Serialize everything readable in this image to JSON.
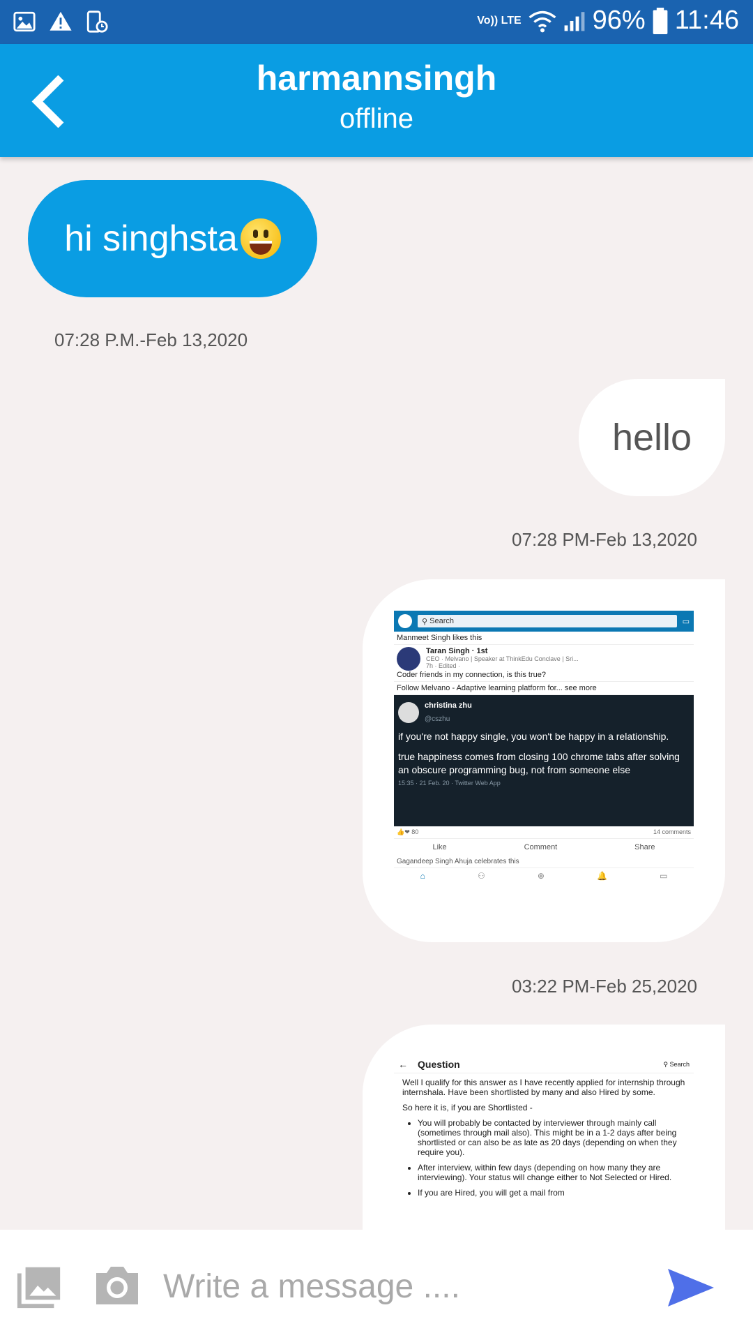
{
  "status_bar": {
    "battery": "96%",
    "time": "11:46",
    "network": "Vo)) LTE"
  },
  "header": {
    "title": "harmannsingh",
    "subtitle": "offline"
  },
  "messages": [
    {
      "direction": "incoming",
      "text": "hi singhsta",
      "timestamp": "07:28 P.M.-Feb 13,2020"
    },
    {
      "direction": "outgoing",
      "text": "hello",
      "timestamp": "07:28 PM-Feb 13,2020"
    },
    {
      "direction": "outgoing",
      "type": "image",
      "timestamp": "03:22 PM-Feb 25,2020"
    },
    {
      "direction": "outgoing",
      "type": "image"
    }
  ],
  "shot1": {
    "search": "Search",
    "liked": "Manmeet Singh likes this",
    "author": "Taran Singh · 1st",
    "author_desc": "CEO · Melvano | Speaker at ThinkEdu Conclave | Sri...",
    "author_time": "7h · Edited ·",
    "post_text": "Coder friends in my connection, is this true?",
    "follow_text": "Follow Melvano - Adaptive learning platform for... see more",
    "tweet_name": "christina zhu",
    "tweet_handle": "@cszhu",
    "tweet_line1": "if you're not happy single, you won't be happy in a relationship.",
    "tweet_line2": "true happiness comes from closing 100 chrome tabs after solving an obscure programming bug, not from someone else",
    "tweet_meta": "15:35 · 21 Feb. 20 · Twitter Web App",
    "reactions": "80",
    "comments": "14 comments",
    "like": "Like",
    "comment": "Comment",
    "share": "Share",
    "next_post": "Gagandeep Singh Ahuja celebrates this"
  },
  "shot2": {
    "title": "Question",
    "search": "Search",
    "p1": "Well I qualify for this answer as I have recently applied for internship through internshala. Have been shortlisted by many and also Hired by some.",
    "p2": "So here it is, if you are Shortlisted -",
    "li1": "You will probably be contacted by interviewer through mainly call (sometimes through mail also). This might be in a 1-2 days after being shortlisted or can also be as late as 20 days (depending on when they require you).",
    "li2": "After interview, within few days (depending on how many they are interviewing). Your status will change either to Not Selected or Hired.",
    "li3": "If you are Hired, you will get a mail from"
  },
  "composer": {
    "placeholder": "Write a message ...."
  },
  "colors": {
    "header": "#0a9de3",
    "status_bar": "#1a63b0",
    "send": "#4f6fe8",
    "background": "#f5f0f0"
  }
}
